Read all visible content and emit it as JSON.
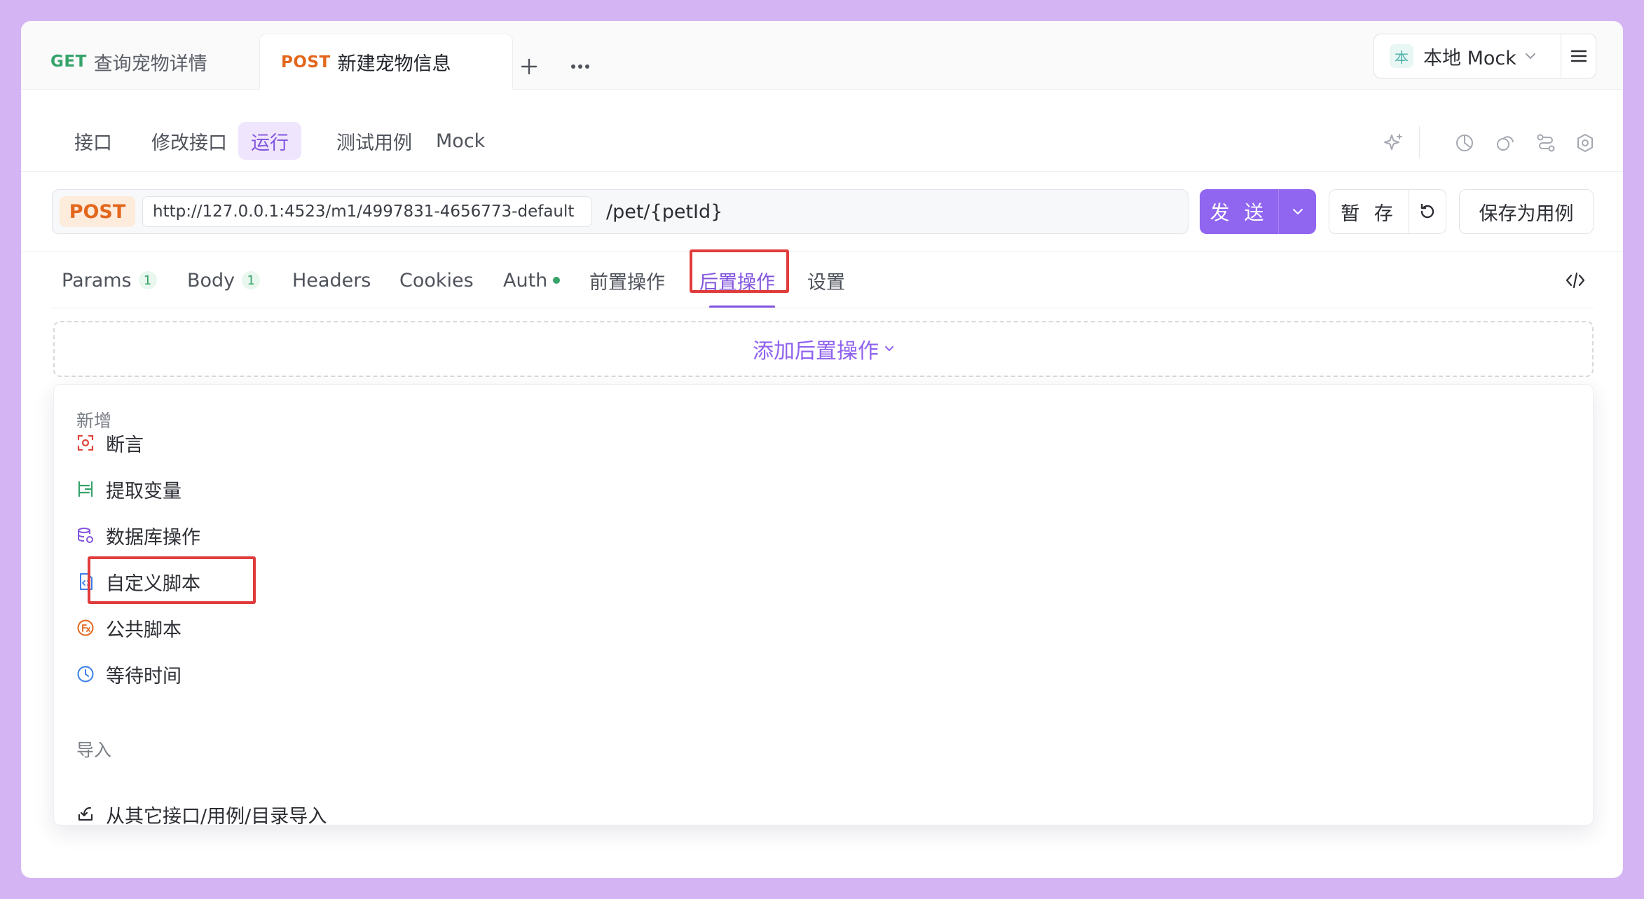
{
  "tabs": [
    {
      "method": "GET",
      "name": "查询宠物详情"
    },
    {
      "method": "POST",
      "name": "新建宠物信息"
    }
  ],
  "environment": {
    "badge": "本",
    "label": "本地 Mock"
  },
  "subnav": {
    "items": [
      "接口",
      "修改接口",
      "运行",
      "测试用例",
      "Mock"
    ],
    "active": "运行"
  },
  "request": {
    "method": "POST",
    "base_url": "http://127.0.0.1:4523/m1/4997831-4656773-default",
    "path": "/pet/{petId}",
    "send_label": "发 送",
    "save_label": "暂 存",
    "save_case_label": "保存为用例"
  },
  "request_tabs": [
    {
      "label": "Params",
      "count": "1"
    },
    {
      "label": "Body",
      "count": "1"
    },
    {
      "label": "Headers"
    },
    {
      "label": "Cookies"
    },
    {
      "label": "Auth"
    },
    {
      "label": "前置操作"
    },
    {
      "label": "后置操作"
    },
    {
      "label": "设置"
    }
  ],
  "active_request_tab": "后置操作",
  "add_post_op_label": "添加后置操作",
  "menu": {
    "section_new": "新增",
    "items": [
      {
        "label": "断言",
        "icon": "assertion-icon"
      },
      {
        "label": "提取变量",
        "icon": "extract-variable-icon"
      },
      {
        "label": "数据库操作",
        "icon": "database-icon"
      },
      {
        "label": "自定义脚本",
        "icon": "script-file-icon"
      },
      {
        "label": "公共脚本",
        "icon": "function-icon"
      },
      {
        "label": "等待时间",
        "icon": "clock-icon"
      }
    ],
    "section_import": "导入",
    "import_item": {
      "label": "从其它接口/用例/目录导入",
      "icon": "import-icon"
    }
  },
  "colors": {
    "accent": "#8254df",
    "get": "#35a36a",
    "post": "#e2671d",
    "highlight": "#e03c3c",
    "background": "#d4b4f3"
  }
}
